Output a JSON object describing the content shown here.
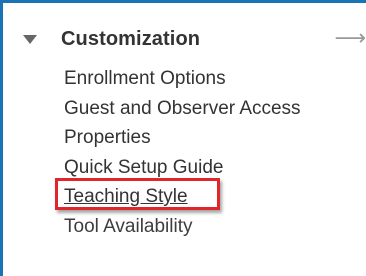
{
  "section": {
    "title": "Customization",
    "toggle_icon": "caret-down-icon",
    "arrow_icon": "right-arrow-icon",
    "arrow_glyph": "⟶"
  },
  "menu": {
    "items": [
      {
        "label": "Enrollment Options"
      },
      {
        "label": "Guest and Observer Access"
      },
      {
        "label": "Properties"
      },
      {
        "label": "Quick Setup Guide"
      },
      {
        "label": "Teaching Style",
        "highlighted": true
      },
      {
        "label": "Tool Availability"
      }
    ]
  },
  "colors": {
    "accent_border": "#1a73b5",
    "highlight": "#e0262b",
    "text": "#333333"
  }
}
